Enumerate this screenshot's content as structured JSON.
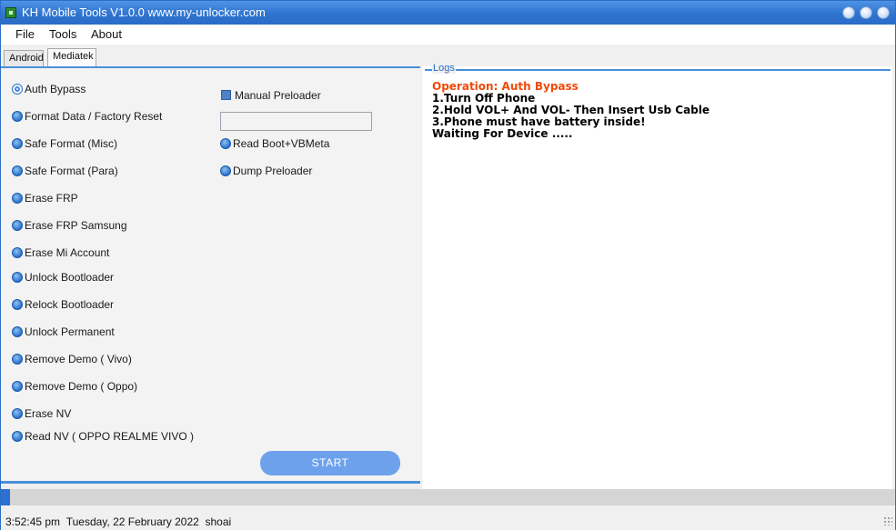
{
  "window": {
    "title": "KH Mobile Tools V1.0.0 www.my-unlocker.com",
    "accent_color": "#2f74d0"
  },
  "menu": {
    "items": [
      "File",
      "Tools",
      "About"
    ]
  },
  "tabs": [
    {
      "label": "Android",
      "selected": false
    },
    {
      "label": "Mediatek",
      "selected": true
    }
  ],
  "operations": [
    {
      "label": "Auth Bypass",
      "selected": true
    },
    {
      "label": "Format Data / Factory Reset",
      "selected": false
    },
    {
      "label": "Safe Format (Misc)",
      "selected": false
    },
    {
      "label": "Safe Format (Para)",
      "selected": false
    },
    {
      "label": "Erase FRP",
      "selected": false
    },
    {
      "label": "Erase FRP Samsung",
      "selected": false
    },
    {
      "label": "Erase Mi Account",
      "selected": false
    },
    {
      "label": "Unlock Bootloader",
      "selected": false
    },
    {
      "label": "Relock Bootloader",
      "selected": false
    },
    {
      "label": "Unlock Permanent",
      "selected": false
    },
    {
      "label": "Remove Demo ( Vivo)",
      "selected": false
    },
    {
      "label": "Remove Demo ( Oppo)",
      "selected": false
    },
    {
      "label": "Erase NV",
      "selected": false
    },
    {
      "label": "Read NV ( OPPO REALME VIVO )",
      "selected": false
    }
  ],
  "preloader": {
    "checkbox_label": "Manual Preloader",
    "checked": true,
    "input_value": ""
  },
  "side_operations": [
    {
      "label": "Read Boot+VBMeta",
      "selected": false
    },
    {
      "label": "Dump Preloader",
      "selected": false
    }
  ],
  "start_button": {
    "label": "START"
  },
  "logs": {
    "title": "Logs",
    "lines": [
      {
        "text": "Operation: Auth Bypass",
        "color": "#f04a0a"
      },
      {
        "text": "1.Turn Off Phone",
        "color": "#000000"
      },
      {
        "text": "2.Hold VOL+ And VOL- Then Insert Usb Cable",
        "color": "#000000"
      },
      {
        "text": "3.Phone must have battery inside!",
        "color": "#000000"
      },
      {
        "text": "Waiting For Device .....",
        "color": "#000000"
      }
    ]
  },
  "progress": {
    "value": 0.01,
    "color": "#2e6fd3"
  },
  "status": {
    "time": "3:52:45 pm",
    "date": "Tuesday, 22 February 2022",
    "user": "shoai"
  }
}
